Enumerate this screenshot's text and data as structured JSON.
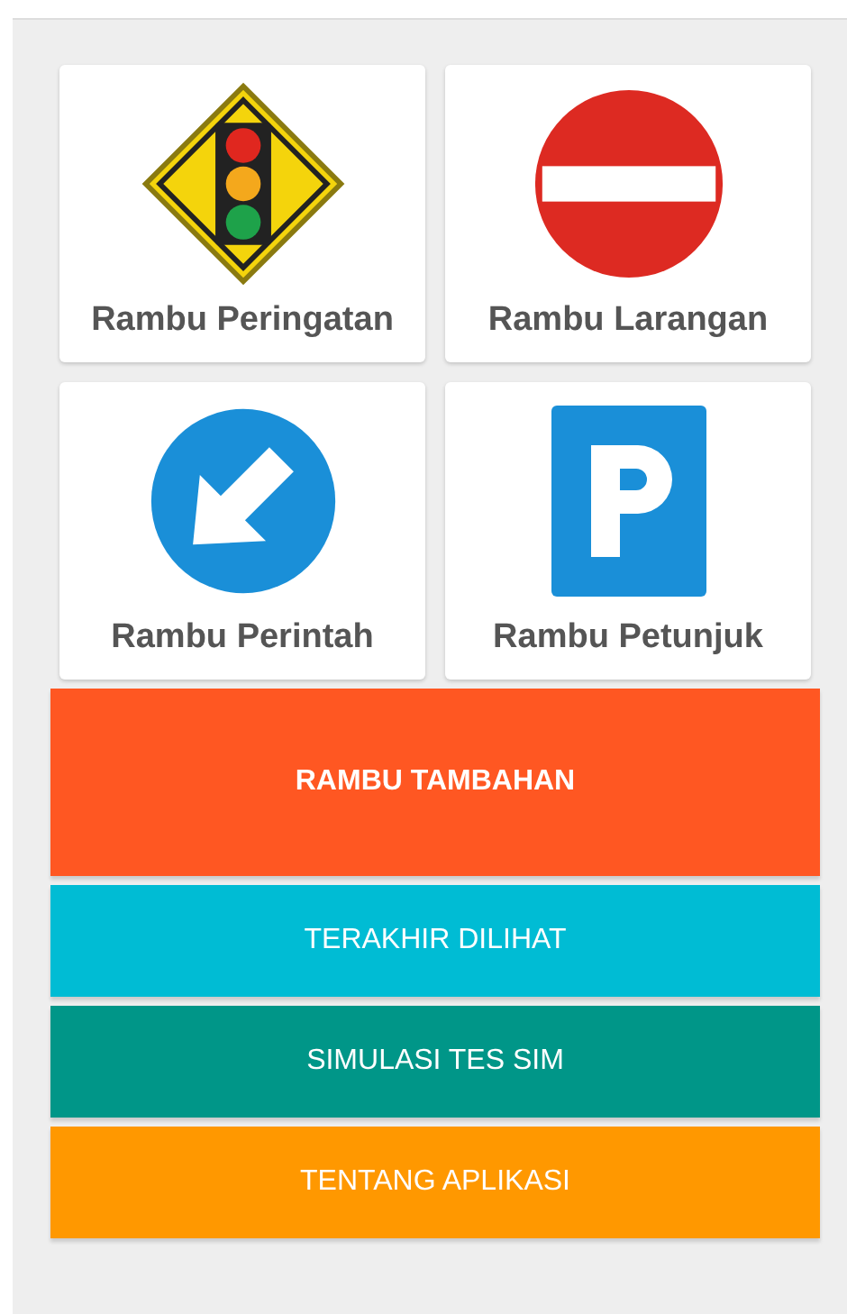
{
  "categories": [
    {
      "label": "Rambu Peringatan",
      "kind": "warning"
    },
    {
      "label": "Rambu Larangan",
      "kind": "prohibition"
    },
    {
      "label": "Rambu Perintah",
      "kind": "command"
    },
    {
      "label": "Rambu Petunjuk",
      "kind": "guide"
    }
  ],
  "buttons": [
    {
      "label": "RAMBU TAMBAHAN",
      "kind": "large",
      "color": "#ff5722"
    },
    {
      "label": "TERAKHIR DILIHAT",
      "kind": "normal",
      "color": "#00bcd4"
    },
    {
      "label": "SIMULASI TES SIM",
      "kind": "normal",
      "color": "#009688"
    },
    {
      "label": "TENTANG APLIKASI",
      "kind": "normal",
      "color": "#ff9800"
    }
  ]
}
